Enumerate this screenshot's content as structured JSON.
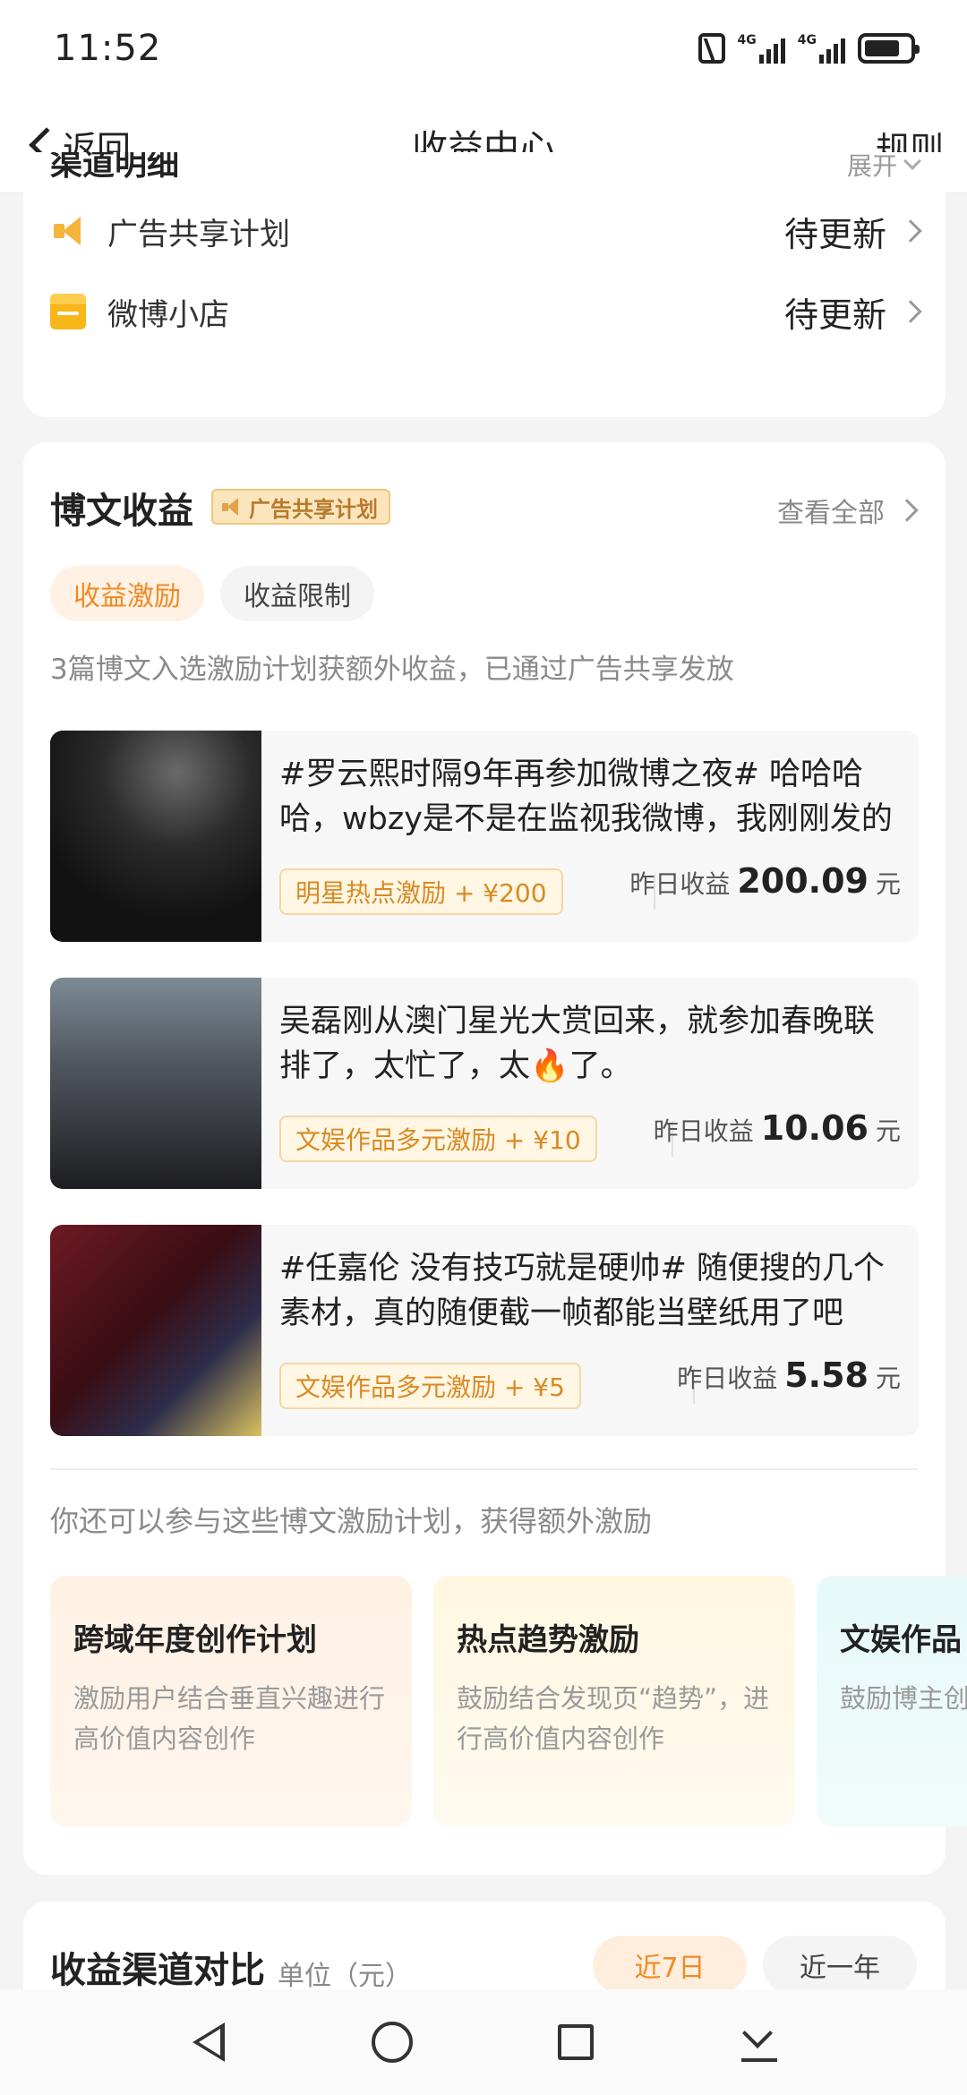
{
  "status_bar": {
    "time": "11:52",
    "net1": "4G",
    "net2": "4G"
  },
  "header": {
    "back_label": "返回",
    "title": "收益中心",
    "rules_label": "规则"
  },
  "channels": {
    "title": "渠道明细",
    "expand_label": "展开",
    "items": [
      {
        "icon": "speaker-icon",
        "name": "广告共享计划",
        "value": "待更新"
      },
      {
        "icon": "shop-icon",
        "name": "微博小店",
        "value": "待更新"
      }
    ]
  },
  "post_income": {
    "title": "博文收益",
    "badge": "广告共享计划",
    "view_all": "查看全部",
    "tabs": [
      {
        "label": "收益激励",
        "active": true
      },
      {
        "label": "收益限制",
        "active": false
      }
    ],
    "description": "3篇博文入选激励计划获额外收益，已通过广告共享发放",
    "posts": [
      {
        "text": "#罗云熙时隔9年再参加微博之夜# 哈哈哈哈，wbzy是不是在监视我微博，我刚刚发的",
        "tag": "明星热点激励 + ¥200",
        "earn_label": "昨日收益",
        "earn_value": "200.09",
        "earn_unit": "元"
      },
      {
        "text": "吴磊刚从澳门星光大赏回来，就参加春晚联排了，太忙了，太🔥了。",
        "tag": "文娱作品多元激励 + ¥10",
        "earn_label": "昨日收益",
        "earn_value": "10.06",
        "earn_unit": "元"
      },
      {
        "text": "#任嘉伦 没有技巧就是硬帅# 随便搜的几个素材，真的随便截一帧都能当壁纸用了吧",
        "tag": "文娱作品多元激励 + ¥5",
        "earn_label": "昨日收益",
        "earn_value": "5.58",
        "earn_unit": "元"
      }
    ],
    "more_description": "你还可以参与这些博文激励计划，获得额外激励",
    "plans": [
      {
        "title": "跨域年度创作计划",
        "desc": "激励用户结合垂直兴趣进行高价值内容创作"
      },
      {
        "title": "热点趋势激励",
        "desc": "鼓励结合发现页“趋势”，进行高价值内容创作"
      },
      {
        "title": "文娱作品",
        "desc": "鼓励博主创视频内"
      }
    ]
  },
  "compare": {
    "title": "收益渠道对比",
    "unit": "单位（元）",
    "ranges": [
      {
        "label": "近7日",
        "active": true
      },
      {
        "label": "近一年",
        "active": false
      }
    ]
  },
  "colors": {
    "accent": "#f08a24",
    "badge_bg": "#fbe5bd",
    "page_bg": "#f4f4f4"
  }
}
